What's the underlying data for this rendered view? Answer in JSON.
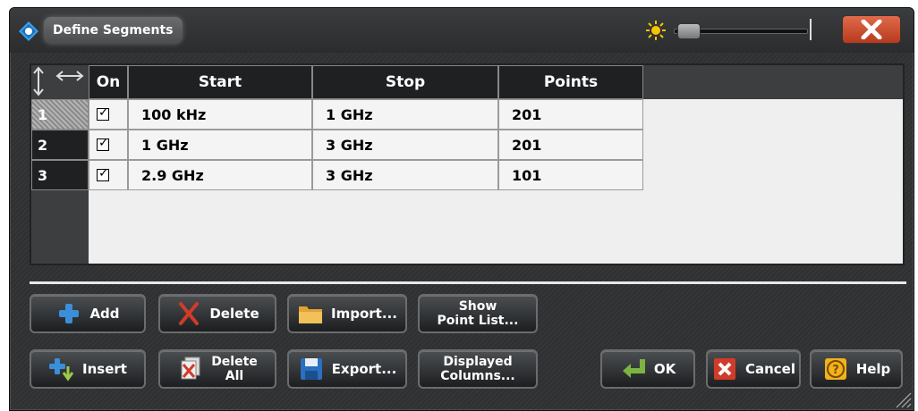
{
  "window": {
    "title": "Define Segments"
  },
  "table": {
    "columns": [
      "On",
      "Start",
      "Stop",
      "Points"
    ],
    "rows": [
      {
        "index": "1",
        "on": true,
        "start": "100 kHz",
        "stop": "1 GHz",
        "points": "201",
        "selected": true
      },
      {
        "index": "2",
        "on": true,
        "start": "1 GHz",
        "stop": "3 GHz",
        "points": "201",
        "selected": false
      },
      {
        "index": "3",
        "on": true,
        "start": "2.9 GHz",
        "stop": "3 GHz",
        "points": "101",
        "selected": false
      }
    ]
  },
  "buttons": {
    "add": "Add",
    "delete": "Delete",
    "import": "Import...",
    "show_point_list_1": "Show",
    "show_point_list_2": "Point List...",
    "insert": "Insert",
    "delete_all_1": "Delete",
    "delete_all_2": "All",
    "export": "Export...",
    "displayed_columns_1": "Displayed",
    "displayed_columns_2": "Columns...",
    "ok": "OK",
    "cancel": "Cancel",
    "help": "Help"
  },
  "icons": {
    "app": "rohde-schwarz-logo-icon",
    "brightness": "sun-icon",
    "close": "close-x-icon",
    "column_resize": "resize-arrows-icon"
  },
  "colors": {
    "close_button": "#c9462a",
    "cancel_icon": "#d03b2a",
    "help_icon": "#f2b21a",
    "ok_icon": "#7cb342",
    "add_icon": "#3a8fd8"
  }
}
